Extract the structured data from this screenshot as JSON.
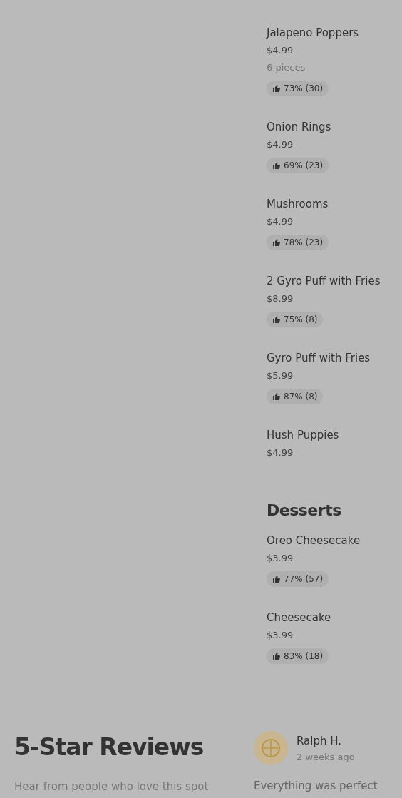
{
  "menu_sections": [
    {
      "items": [
        {
          "name": "Jalapeno Poppers",
          "price": "$4.99",
          "description": "6 pieces",
          "rating": "73% (30)"
        },
        {
          "name": "Onion Rings",
          "price": "$4.99",
          "rating": "69% (23)"
        },
        {
          "name": "Mushrooms",
          "price": "$4.99",
          "rating": "78% (23)"
        },
        {
          "name": "2 Gyro Puff with Fries",
          "price": "$8.99",
          "rating": "75% (8)"
        },
        {
          "name": "Gyro Puff with Fries",
          "price": "$5.99",
          "rating": "87% (8)"
        },
        {
          "name": "Hush Puppies",
          "price": "$4.99"
        }
      ]
    },
    {
      "title": "Desserts",
      "items": [
        {
          "name": "Oreo Cheesecake",
          "price": "$3.99",
          "rating": "77% (57)"
        },
        {
          "name": "Cheesecake",
          "price": "$3.99",
          "rating": "83% (18)"
        }
      ]
    }
  ],
  "reviews": {
    "title": "5-Star Reviews",
    "subtitle": "Hear from people who love this spot",
    "items": [
      {
        "author": "Ralph H.",
        "time": "2 weeks ago",
        "text": "Everything was perfect"
      }
    ]
  }
}
